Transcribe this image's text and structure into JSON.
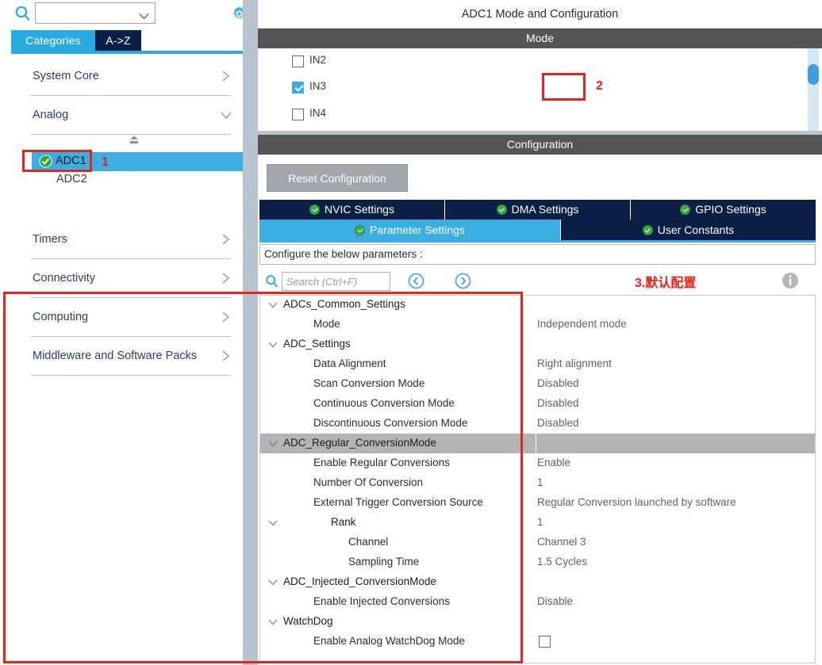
{
  "left": {
    "search": {
      "value": "",
      "icon": "search-icon",
      "chevron": "chevron-down-icon"
    },
    "gear": "gear-icon",
    "tabs": [
      {
        "label": "Categories",
        "active": true
      },
      {
        "label": "A->Z",
        "active": false
      }
    ],
    "categories": [
      {
        "label": "System Core",
        "expanded": false,
        "arrow": "chevron-right-icon"
      },
      {
        "label": "Analog",
        "expanded": true,
        "arrow": "chevron-down-icon"
      },
      {
        "label": "Timers",
        "expanded": false,
        "arrow": "chevron-right-icon"
      },
      {
        "label": "Connectivity",
        "expanded": false,
        "arrow": "chevron-right-icon"
      },
      {
        "label": "Computing",
        "expanded": false,
        "arrow": "chevron-right-icon"
      },
      {
        "label": "Middleware and Software Packs",
        "expanded": false,
        "arrow": "chevron-right-icon"
      }
    ],
    "peripherals": [
      {
        "label": "ADC1",
        "selected": true,
        "configured": true
      },
      {
        "label": "ADC2",
        "selected": false,
        "configured": false
      }
    ]
  },
  "annotations": {
    "one": "1",
    "two": "2",
    "three": "3.默认配置"
  },
  "right": {
    "title": "ADC1 Mode and Configuration",
    "mode_header": "Mode",
    "mode_items": [
      {
        "label": "IN2",
        "checked": false
      },
      {
        "label": "IN3",
        "checked": true
      },
      {
        "label": "IN4",
        "checked": false
      }
    ],
    "configuration_header": "Configuration",
    "reset_button": "Reset Configuration",
    "tabs_row1": [
      {
        "label": "NVIC Settings",
        "active": false
      },
      {
        "label": "DMA Settings",
        "active": false
      },
      {
        "label": "GPIO Settings",
        "active": false
      }
    ],
    "tabs_row2": [
      {
        "label": "Parameter Settings",
        "active": true
      },
      {
        "label": "User Constants",
        "active": false
      }
    ],
    "configure_hint": "Configure the below parameters :",
    "param_search_placeholder": "Search (Ctrl+F)",
    "nav_prev": "prev-search-result-icon",
    "nav_next": "next-search-result-icon",
    "info": "info-icon",
    "tree": [
      {
        "type": "group",
        "indent": 0,
        "twisty": true,
        "name": "ADCs_Common_Settings",
        "value": "",
        "selected": false
      },
      {
        "type": "leaf",
        "indent": 1,
        "twisty": false,
        "name": "Mode",
        "value": "Independent mode",
        "selected": false
      },
      {
        "type": "group",
        "indent": 0,
        "twisty": true,
        "name": "ADC_Settings",
        "value": "",
        "selected": false
      },
      {
        "type": "leaf",
        "indent": 1,
        "twisty": false,
        "name": "Data Alignment",
        "value": "Right alignment",
        "selected": false
      },
      {
        "type": "leaf",
        "indent": 1,
        "twisty": false,
        "name": "Scan Conversion Mode",
        "value": "Disabled",
        "selected": false
      },
      {
        "type": "leaf",
        "indent": 1,
        "twisty": false,
        "name": "Continuous Conversion Mode",
        "value": "Disabled",
        "selected": false
      },
      {
        "type": "leaf",
        "indent": 1,
        "twisty": false,
        "name": "Discontinuous Conversion Mode",
        "value": "Disabled",
        "selected": false
      },
      {
        "type": "group",
        "indent": 0,
        "twisty": true,
        "name": "ADC_Regular_ConversionMode",
        "value": "",
        "selected": true
      },
      {
        "type": "leaf",
        "indent": 1,
        "twisty": false,
        "name": "Enable Regular Conversions",
        "value": "Enable",
        "selected": false
      },
      {
        "type": "leaf",
        "indent": 1,
        "twisty": false,
        "name": "Number Of Conversion",
        "value": "1",
        "selected": false
      },
      {
        "type": "leaf",
        "indent": 1,
        "twisty": false,
        "name": "External Trigger Conversion Source",
        "value": "Regular Conversion launched by software",
        "selected": false
      },
      {
        "type": "group",
        "indent": 2,
        "twisty": true,
        "name": "Rank",
        "value": "1",
        "selected": false
      },
      {
        "type": "leaf",
        "indent": 3,
        "twisty": false,
        "name": "Channel",
        "value": "Channel 3",
        "selected": false
      },
      {
        "type": "leaf",
        "indent": 3,
        "twisty": false,
        "name": "Sampling Time",
        "value": "1.5 Cycles",
        "selected": false
      },
      {
        "type": "group",
        "indent": 0,
        "twisty": true,
        "name": "ADC_Injected_ConversionMode",
        "value": "",
        "selected": false
      },
      {
        "type": "leaf",
        "indent": 1,
        "twisty": false,
        "name": "Enable Injected Conversions",
        "value": "Disable",
        "selected": false
      },
      {
        "type": "group",
        "indent": 0,
        "twisty": true,
        "name": "WatchDog",
        "value": "",
        "selected": false
      },
      {
        "type": "checkbox",
        "indent": 1,
        "twisty": false,
        "name": "Enable Analog WatchDog Mode",
        "value": "",
        "checked": false,
        "selected": false
      }
    ]
  },
  "colors": {
    "accent_blue": "#3cade2",
    "tab_navy": "#0c2045",
    "header_gray": "#555555",
    "annotation_red": "#e8231a",
    "check_green": "#3faa43",
    "selected_row": "#b4b4b4"
  }
}
